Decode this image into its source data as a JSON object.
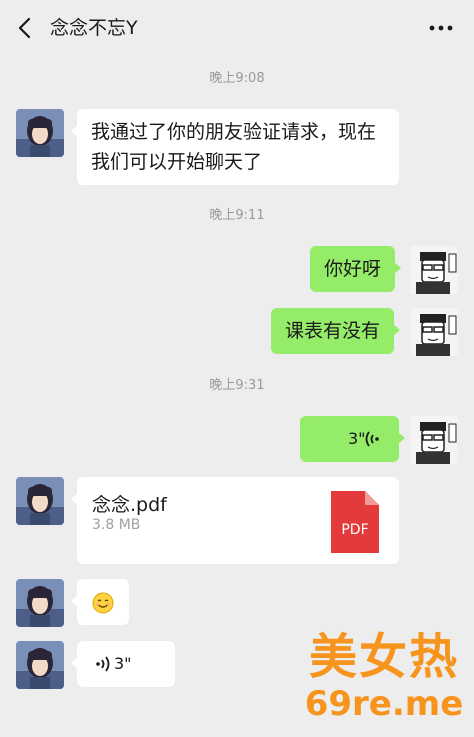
{
  "header": {
    "title": "念念不忘Y"
  },
  "messages": {
    "time1": "晚上9:08",
    "msg1": "我通过了你的朋友验证请求，现在我们可以开始聊天了",
    "time2": "晚上9:11",
    "msg2": "你好呀",
    "msg3": "课表有没有",
    "time3": "晚上9:31",
    "voice_out": "3\"",
    "file": {
      "name": "念念.pdf",
      "size": "3.8 MB",
      "icon_label": "PDF"
    },
    "emoji": "smiling-face",
    "voice_in": "3\""
  },
  "watermark": {
    "line1": "美女热",
    "line2": "69re.me"
  },
  "colors": {
    "background": "#ededed",
    "sent_bubble": "#95ec69",
    "received_bubble": "#ffffff",
    "pdf_red": "#e33b3b",
    "watermark": "#f7941d"
  }
}
